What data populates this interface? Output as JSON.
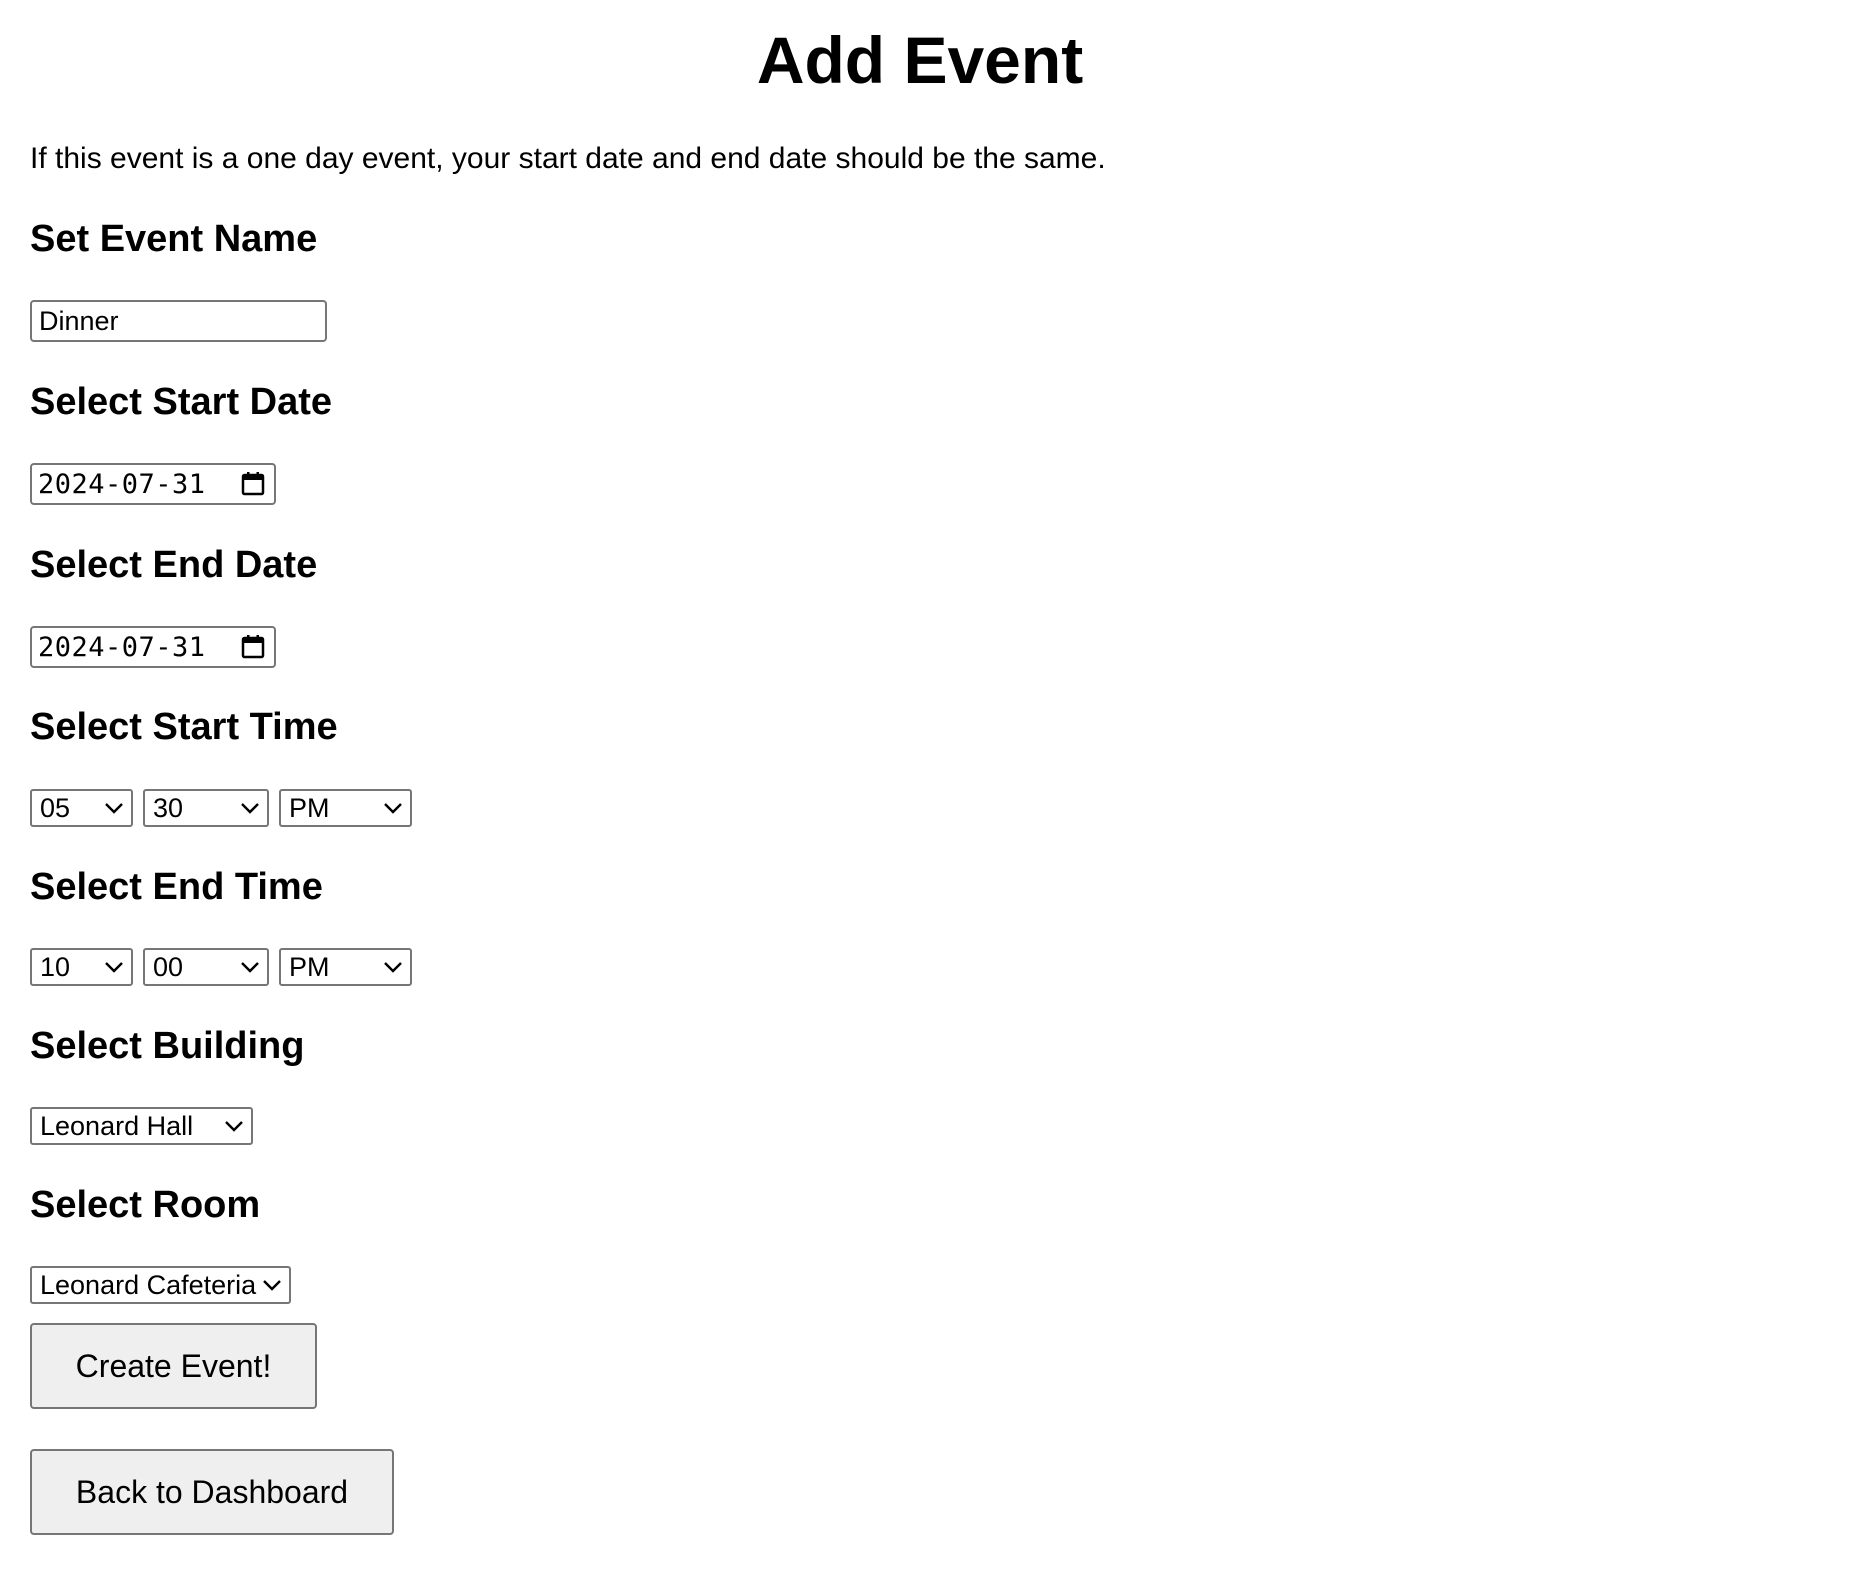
{
  "header": {
    "title": "Add Event"
  },
  "intro_text": "If this event is a one day event, your start date and end date should be the same.",
  "event_name": {
    "heading": "Set Event Name",
    "value": "Dinner"
  },
  "start_date": {
    "heading": "Select Start Date",
    "value": "2024-07-31",
    "icon": "calendar-icon"
  },
  "end_date": {
    "heading": "Select End Date",
    "value": "2024-07-31",
    "icon": "calendar-icon"
  },
  "start_time": {
    "heading": "Select Start Time",
    "hour": "05",
    "minute": "30",
    "ampm": "PM"
  },
  "end_time": {
    "heading": "Select End Time",
    "hour": "10",
    "minute": "00",
    "ampm": "PM"
  },
  "building": {
    "heading": "Select Building",
    "selected": "Leonard Hall"
  },
  "room": {
    "heading": "Select Room",
    "selected": "Leonard Cafeteria"
  },
  "buttons": {
    "create_label": "Create Event!",
    "back_label": "Back to Dashboard"
  },
  "colors": {
    "border": "#767676",
    "button_bg": "#efefef",
    "text": "#000000"
  }
}
